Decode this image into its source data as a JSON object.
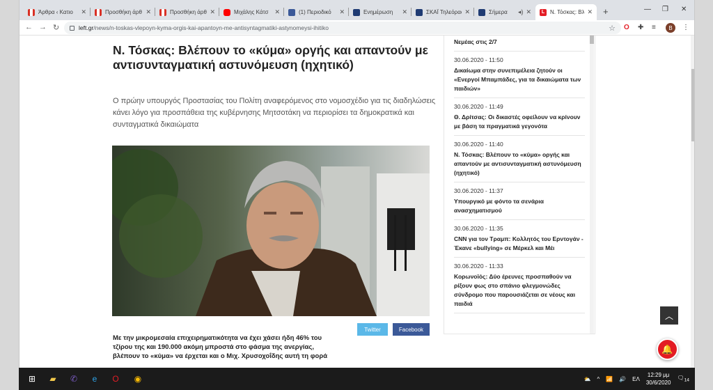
{
  "tabs": [
    {
      "title": "Άρθρα ‹ Κατιο",
      "icon": "red"
    },
    {
      "title": "Προσθήκη άρθ",
      "icon": "red"
    },
    {
      "title": "Προσθήκη άρθ",
      "icon": "red"
    },
    {
      "title": "Μιχάλης Κάτσ",
      "icon": "yt"
    },
    {
      "title": "(1) Περιοδικό",
      "icon": "fb"
    },
    {
      "title": "Ενημέρωση",
      "icon": "ert"
    },
    {
      "title": "ΣΚΑΪ Τηλεόρασ",
      "icon": "ert"
    },
    {
      "title": "Σήμερα",
      "icon": "ert"
    },
    {
      "title": "Ν. Τόσκας: Βλέ",
      "icon": "lf",
      "active": true
    }
  ],
  "address": {
    "host": "left.gr",
    "path": "/news/n-toskas-vlepoyn-kyma-orgis-kai-apantoyn-me-antisyntagmatiki-astynomeysi-ihitiko"
  },
  "profile_initial": "B",
  "article": {
    "headline": "Ν. Τόσκας: Βλέπουν το «κύμα» οργής και απαντούν με αντισυνταγματική αστυνόμευση (ηχητικό)",
    "lead": "Ο πρώην υπουργός Προστασίας του Πολίτη αναφερόμενος στο νομοσχέδιο για τις διαδηλώσεις κάνει λόγο για προσπάθεια της κυβέρνησης Μητσοτάκη να περιορίσει τα δημοκρατικά και συνταγματικά δικαιώματα",
    "twitter_label": "Twitter",
    "facebook_label": "Facebook",
    "body": "Με την μικρομεσαία επιχειρηματικότητα να έχει χάσει ήδη 46% του τζίρου της και 190.000 ακόμη μπροστά στο φάσμα της ανεργίας, βλέπουν το «κύμα» να έρχεται και ο Μιχ. Χρυσοχοΐδης αυτή τη φορά"
  },
  "news": [
    {
      "time": "",
      "headline": "Νεμέας στις 2/7"
    },
    {
      "time": "30.06.2020 - 11:50",
      "headline": "Δικαίωμα στην συνεπιμέλεια ζητούν οι «Ενεργοί Μπαμπάδες, για τα δικαιώματα των παιδιών»"
    },
    {
      "time": "30.06.2020 - 11:49",
      "headline": "Θ. Δρίτσας: Οι δικαστές οφείλουν να κρίνουν με βάση τα πραγματικά γεγονότα"
    },
    {
      "time": "30.06.2020 - 11:40",
      "headline": "Ν. Τόσκας: Βλέπουν το «κύμα» οργής και απαντούν με αντισυνταγματική αστυνόμευση (ηχητικό)"
    },
    {
      "time": "30.06.2020 - 11:37",
      "headline": "Υπουργικό με φόντο τα σενάρια ανασχηματισμού"
    },
    {
      "time": "30.06.2020 - 11:35",
      "headline": "CNN για τον Τραμπ: Κολλητός του Ερντογάν - Έκανε «bullying» σε Μέρκελ και Μέι"
    },
    {
      "time": "30.06.2020 - 11:33",
      "headline": "Κορωνοϊός: Δύο έρευνες προσπαθούν να ρίξουν φως στο σπάνιο φλεγμονώδες σύνδρομο που παρουσιάζεται σε νέους και παιδιά"
    }
  ],
  "taskbar": {
    "language": "ΕΛ",
    "time": "12:29 μμ",
    "date": "30/6/2020",
    "notifications": "14"
  }
}
